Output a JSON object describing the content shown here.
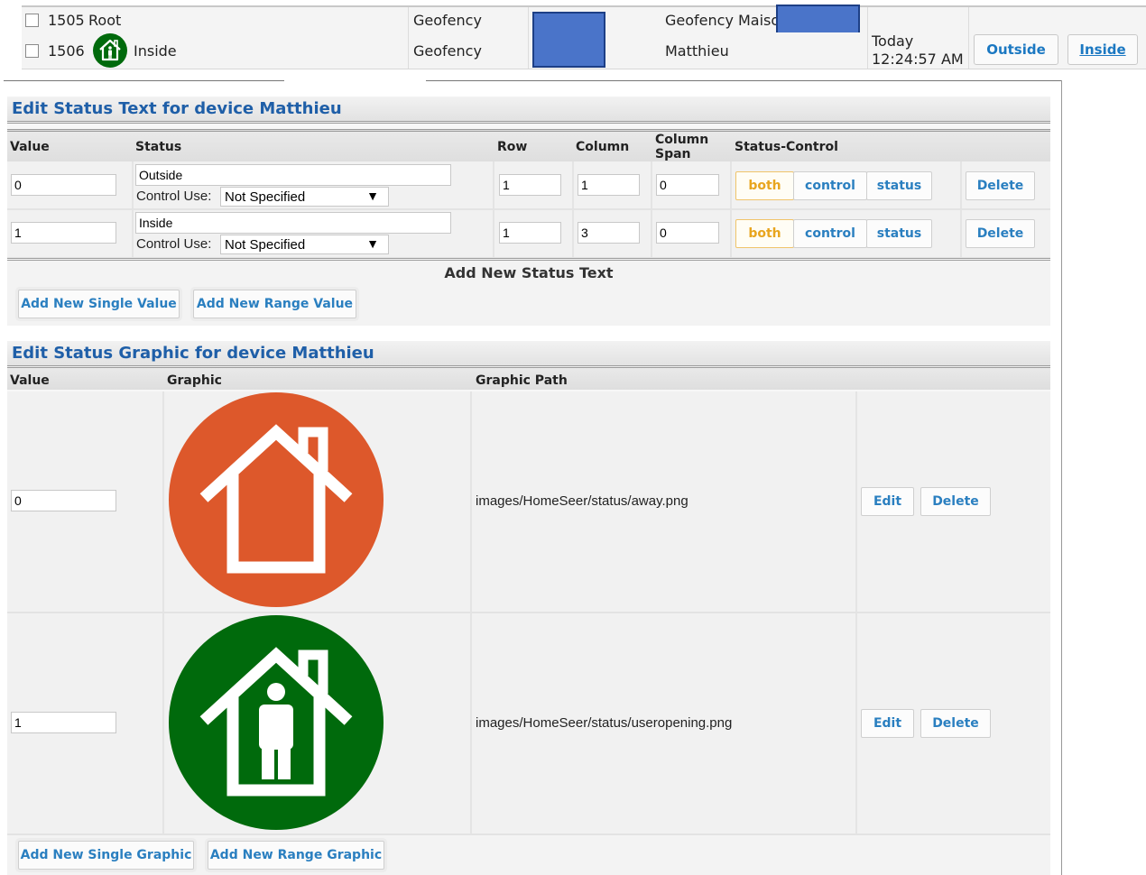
{
  "devices": [
    {
      "id": "1505",
      "name": "Root",
      "type": "Geofency",
      "location": "Geofency Maison",
      "time_line1": "",
      "time_line2": ""
    },
    {
      "id": "1506",
      "name": "Inside",
      "type": "Geofency",
      "location": "Matthieu",
      "time_line1": "Today",
      "time_line2": "12:24:57 AM",
      "btn_outside": "Outside",
      "btn_inside": "Inside"
    }
  ],
  "status_text": {
    "title": "Edit Status Text for device Matthieu",
    "headers": {
      "value": "Value",
      "status": "Status",
      "row": "Row",
      "column": "Column",
      "span_line1": "Column",
      "span_line2": "Span",
      "control": "Status-Control"
    },
    "control_use_label": "Control Use:",
    "rows": [
      {
        "value": "0",
        "status": "Outside",
        "control_use": "Not Specified",
        "row": "1",
        "column": "1",
        "span": "0"
      },
      {
        "value": "1",
        "status": "Inside",
        "control_use": "Not Specified",
        "row": "1",
        "column": "3",
        "span": "0"
      }
    ],
    "btn_both": "both",
    "btn_control": "control",
    "btn_status": "status",
    "btn_delete": "Delete",
    "add_title": "Add New Status Text",
    "add_single": "Add New Single Value",
    "add_range": "Add New Range Value"
  },
  "status_graphic": {
    "title": "Edit Status Graphic for device Matthieu",
    "headers": {
      "value": "Value",
      "graphic": "Graphic",
      "path": "Graphic Path"
    },
    "rows": [
      {
        "value": "0",
        "path": "images/HomeSeer/status/away.png",
        "icon": "away-house-icon",
        "color": "#dd582b"
      },
      {
        "value": "1",
        "path": "images/HomeSeer/status/useropening.png",
        "icon": "person-in-house-icon",
        "color": "#006a0c"
      }
    ],
    "btn_edit": "Edit",
    "btn_delete": "Delete",
    "add_single": "Add New Single Graphic",
    "add_range": "Add New Range Graphic"
  }
}
